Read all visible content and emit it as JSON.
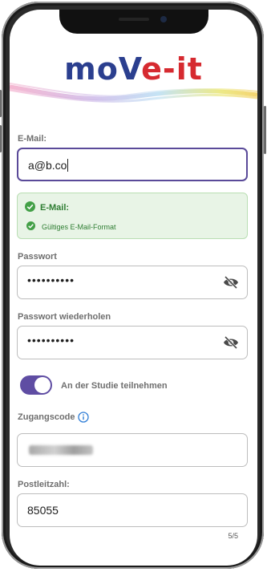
{
  "app": {
    "logo_part1": "moV",
    "logo_part2": "e-",
    "logo_part3": "it"
  },
  "email": {
    "label": "E-Mail:",
    "value": "a@b.co"
  },
  "validation": {
    "title": "E-Mail:",
    "message": "Gültiges E-Mail-Format",
    "color": "#43a047"
  },
  "password": {
    "label": "Passwort",
    "value": "••••••••••"
  },
  "password_repeat": {
    "label": "Passwort wiederholen",
    "value": "••••••••••"
  },
  "study_toggle": {
    "label": "An der Studie teilnehmen",
    "checked": true,
    "color": "#5f4da3"
  },
  "access_code": {
    "label": "Zugangscode"
  },
  "postal_code": {
    "label": "Postleitzahl:",
    "value": "85055"
  },
  "pagination": {
    "text": "5/5"
  },
  "colors": {
    "brand_blue": "#2b3f8f",
    "brand_red": "#d62a30",
    "focus_border": "#5a4a99"
  }
}
